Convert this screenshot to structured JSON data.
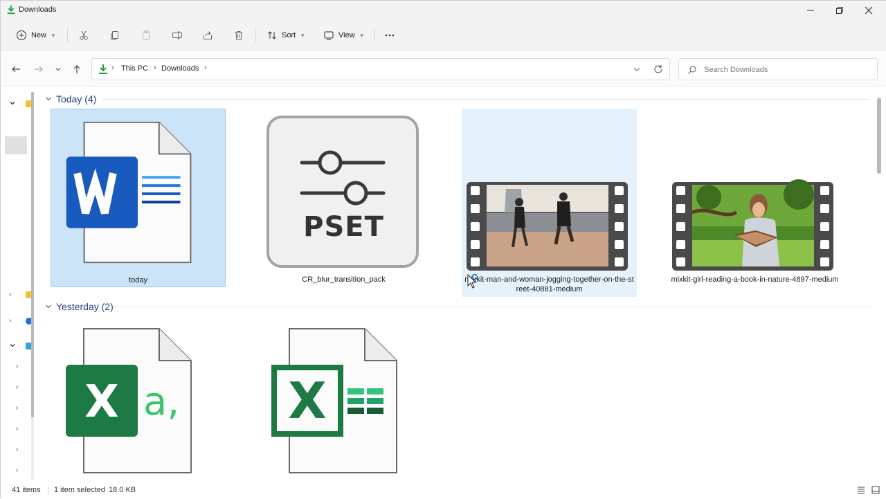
{
  "window": {
    "title": "Downloads",
    "controls": {
      "minimize": "minimize",
      "maximize": "maximize",
      "close": "close"
    }
  },
  "commandbar": {
    "new_label": "New",
    "sort_label": "Sort",
    "view_label": "View",
    "icons": [
      "cut-icon",
      "copy-icon",
      "paste-icon",
      "rename-icon",
      "share-icon",
      "delete-icon",
      "more-icon"
    ]
  },
  "address": {
    "crumbs": [
      "This PC",
      "Downloads"
    ],
    "search_placeholder": "Search Downloads"
  },
  "groups": [
    {
      "header": "Today (4)"
    },
    {
      "header": "Yesterday (2)"
    }
  ],
  "files_today": [
    {
      "name": "today",
      "type": "word",
      "state": "selected"
    },
    {
      "name": "CR_blur_transition_pack",
      "type": "pset",
      "state": "normal",
      "icon_text": "PSET"
    },
    {
      "name": "mixkit-man-and-woman-jogging-together-on-the-street-40881-medium",
      "type": "video",
      "state": "hover"
    },
    {
      "name": "mixkit-girl-reading-a-book-in-nature-4897-medium",
      "type": "video",
      "state": "normal"
    }
  ],
  "files_yesterday": [
    {
      "name": "",
      "type": "excel-csv",
      "icon_text": "X",
      "icon_suffix": "a,"
    },
    {
      "name": "",
      "type": "excel-sheet",
      "icon_text": "X"
    }
  ],
  "status": {
    "item_count": "41 items",
    "selection": "1 item selected",
    "size": "18.0 KB"
  },
  "colors": {
    "accent": "#2a3e82",
    "selected_bg": "#cce4f7",
    "word_blue": "#185abd",
    "excel_green": "#1d7a45",
    "download_green": "#1a9e3e"
  }
}
